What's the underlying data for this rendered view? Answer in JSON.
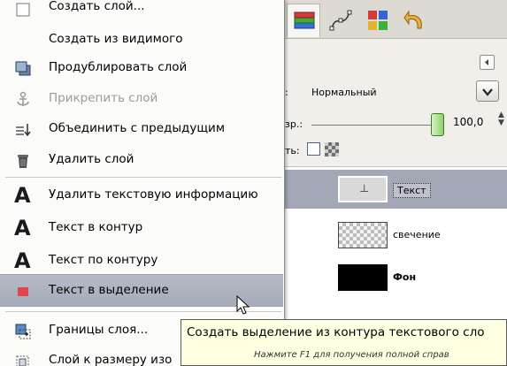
{
  "context_menu": {
    "items": [
      {
        "label": "Создать слой...",
        "icon": "new-layer-icon",
        "disabled": false
      },
      {
        "label": "Создать из видимого",
        "icon": "",
        "disabled": false
      },
      {
        "label": "Продублировать слой",
        "icon": "duplicate-layer-icon",
        "disabled": false
      },
      {
        "label": "Прикрепить слой",
        "icon": "anchor-icon",
        "disabled": true
      },
      {
        "label": "Объединить с предыдущим",
        "icon": "merge-down-icon",
        "disabled": false
      },
      {
        "label": "Удалить слой",
        "icon": "delete-layer-icon",
        "disabled": false
      },
      {
        "label": "Удалить текстовую информацию",
        "icon": "text-tool-icon",
        "disabled": false
      },
      {
        "label": "Текст в контур",
        "icon": "text-tool-icon",
        "disabled": false
      },
      {
        "label": "Текст по контуру",
        "icon": "text-tool-icon",
        "disabled": false
      },
      {
        "label": "Текст в выделение",
        "icon": "text-to-selection-icon",
        "disabled": false,
        "highlighted": true
      },
      {
        "label": "Границы слоя...",
        "icon": "layer-boundary-icon",
        "disabled": false
      },
      {
        "label": "Слой к размеру изо",
        "icon": "layer-to-image-size-icon",
        "disabled": false
      }
    ]
  },
  "tooltip": {
    "text": "Создать выделение из контура текстового сло",
    "hint": "Нажмите F1 для получения полной справ"
  },
  "layers_panel": {
    "mode_label": ":",
    "mode_value": "Нормальный",
    "opacity_label": "зр.:",
    "opacity_value": "100,0",
    "opacity_fraction": 1.0,
    "lock_label": "ть:",
    "layers": [
      {
        "name": "Текст",
        "thumb": "text",
        "selected": true
      },
      {
        "name": "свечение",
        "thumb": "checker",
        "selected": false
      },
      {
        "name": "Фон",
        "thumb": "black",
        "selected": false
      }
    ]
  },
  "colors": {
    "highlight": "#a6acba",
    "tooltip_bg": "#ffffe1",
    "selected_layer": "#a2a8b6"
  }
}
